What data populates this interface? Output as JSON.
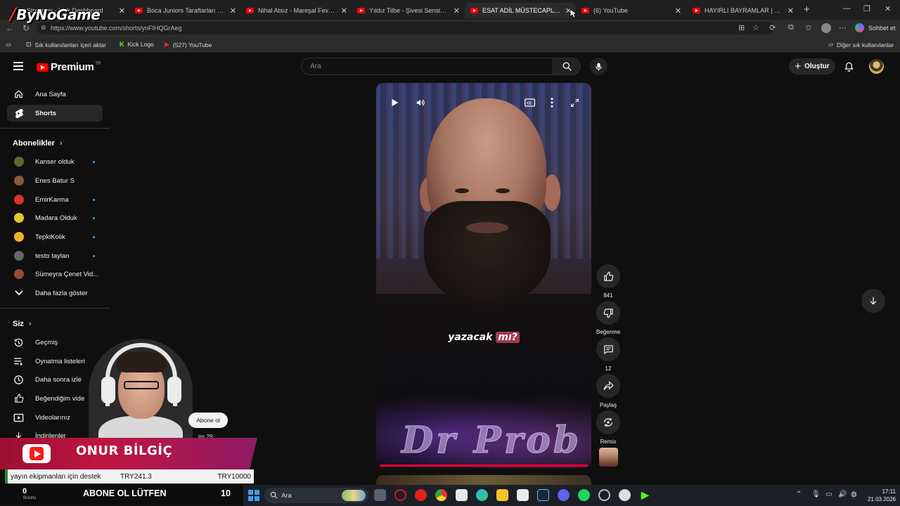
{
  "browser": {
    "brand_logo": "ByNoGame",
    "tabs": [
      {
        "label": "Streamer - Kick Dashboard",
        "active": false
      },
      {
        "label": "Boca Juniors Taraftarları #bocajuniors",
        "active": false
      },
      {
        "label": "Nihal Atsız - Mareşal Fevzi Çakmak",
        "active": false
      },
      {
        "label": "Yıldız Tilbe - Şivesi Sensin Aşkın #şi",
        "active": false
      },
      {
        "label": "ESAT ADİL MÜSTECAPLIOĞLU - YouTube",
        "active": true
      },
      {
        "label": "(6) YouTube",
        "active": false
      },
      {
        "label": "HAYIRLI BAYRAMLAR | Kanser olduk",
        "active": false
      }
    ],
    "url": "https://www.youtube.com/shorts/ynFIHQGrAeg",
    "copilot_label": "Sohbet et",
    "bookmarks": [
      {
        "label": "Sık kullanılanları içeri aktar"
      },
      {
        "label": "Kick Logo"
      },
      {
        "label": "(527) YouTube"
      }
    ],
    "other_bookmarks": "Diğer sık kullanılanlar"
  },
  "youtube": {
    "logo_word": "Premium",
    "logo_region": "TR",
    "search_placeholder": "Ara",
    "create_label": "Oluştur"
  },
  "sidebar": {
    "main": [
      {
        "label": "Ana Sayfa",
        "icon": "home-icon"
      },
      {
        "label": "Shorts",
        "icon": "shorts-icon",
        "selected": true
      }
    ],
    "subs_heading": "Abonelikler",
    "subscriptions": [
      {
        "label": "Kanser olduk",
        "dot": true,
        "color": "#5a6b2e"
      },
      {
        "label": "Enes Batur S",
        "dot": false,
        "color": "#8a5a3a"
      },
      {
        "label": "EmirKarma",
        "dot": true,
        "color": "#d8322a"
      },
      {
        "label": "Madara Olduk",
        "dot": true,
        "color": "#e5c62e"
      },
      {
        "label": "TepkiKolik",
        "dot": true,
        "color": "#f0b22a"
      },
      {
        "label": "testo taylan",
        "dot": true,
        "color": "#666666"
      },
      {
        "label": "Sümeyra Çenet Vid...",
        "dot": false,
        "color": "#9a4a32"
      }
    ],
    "show_more": "Daha fazla göster",
    "you_heading": "Siz",
    "you_items": [
      {
        "label": "Geçmiş",
        "icon": "history-icon"
      },
      {
        "label": "Oynatma listeleri",
        "icon": "playlists-icon"
      },
      {
        "label": "Daha sonra izle",
        "icon": "watch-later-icon"
      },
      {
        "label": "Beğendiğim vide",
        "icon": "liked-icon"
      },
      {
        "label": "Videolarınız",
        "icon": "your-videos-icon"
      },
      {
        "label": "İndirilenler",
        "icon": "downloads-icon"
      }
    ]
  },
  "short": {
    "caption_plain": "yazacak",
    "caption_highlight": "mı?",
    "logo_text": "Dr Prob"
  },
  "actions": {
    "like_count": "841",
    "dislike_label": "Beğenme",
    "comment_count": "12",
    "share_label": "Paylaş",
    "remix_label": "Remix"
  },
  "stream_overlay": {
    "subscribe_bubble": "Abone ol",
    "partial_side_text": "im 29",
    "streamer_name": "ONUR BİLGİÇ",
    "donation_text": "yayın ekipmanları için destek",
    "donation_current": "TRY241.3",
    "donation_goal": "TRY10000",
    "counter_value": "0",
    "counter_sub": "Bulutlu",
    "abone_text": "ABONE OL LÜTFEN",
    "abone_count": "10"
  },
  "taskbar": {
    "search_placeholder": "Ara",
    "time": "17:11",
    "date": "21.03.2026"
  }
}
